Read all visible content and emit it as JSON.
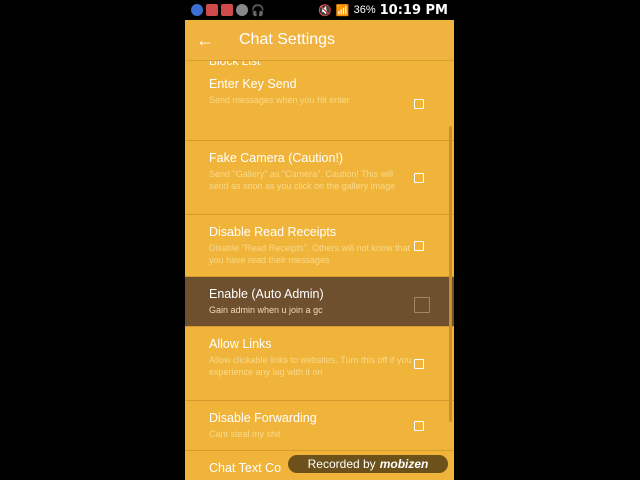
{
  "status_bar": {
    "battery": "36%",
    "time": "10:19 PM"
  },
  "app_bar": {
    "back_icon": "arrow-left",
    "title": "Chat Settings"
  },
  "partial_top_item": "Block List",
  "settings": [
    {
      "title": "Enter Key Send",
      "subtitle": "Send messages when you hit enter",
      "checked": false,
      "active": false
    },
    {
      "title": "Fake Camera (Caution!)",
      "subtitle": "Send \"Gallery\" as \"Camera\". Caution! This will send as soon as you click on the gallery image",
      "checked": false,
      "active": false
    },
    {
      "title": "Disable Read Receipts",
      "subtitle": "Disable \"Read Receipts\". Others will not know that you have read their messages",
      "checked": false,
      "active": false
    },
    {
      "title": "Enable (Auto Admin)",
      "subtitle": "Gain admin when u join a gc",
      "checked": false,
      "active": true
    },
    {
      "title": "Allow Links",
      "subtitle": "Allow clickable links to websites. Turn this off if you experience any lag with it on",
      "checked": false,
      "active": false
    },
    {
      "title": "Disable Forwarding",
      "subtitle": "Cant steal my shit",
      "checked": false,
      "active": false
    },
    {
      "title": "Chat Text Co",
      "subtitle": "",
      "checked": false,
      "active": false
    }
  ],
  "watermark": {
    "text": "Recorded by",
    "brand": "mobizen"
  },
  "colors": {
    "background": "#f0b43a",
    "active_row": "#6e4f2e"
  }
}
